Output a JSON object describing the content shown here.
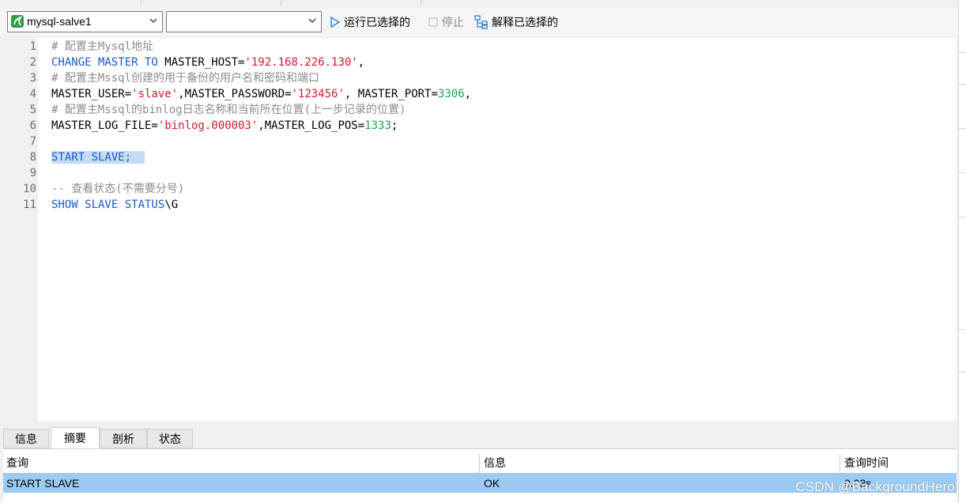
{
  "toolbar": {
    "connection": "mysql-salve1",
    "database": "",
    "run_selected": "运行已选择的",
    "stop": "停止",
    "explain_selected": "解释已选择的"
  },
  "editor": {
    "line_numbers": [
      "1",
      "2",
      "3",
      "4",
      "5",
      "6",
      "7",
      "8",
      "9",
      "10",
      "11"
    ],
    "lines": [
      [
        {
          "t": "# 配置主Mysql地址",
          "c": "cmt"
        }
      ],
      [
        {
          "t": "CHANGE MASTER TO",
          "c": "kw"
        },
        {
          "t": " MASTER_HOST=",
          "c": ""
        },
        {
          "t": "'192.168.226.130'",
          "c": "str"
        },
        {
          "t": ",",
          "c": ""
        }
      ],
      [
        {
          "t": "# 配置主Mssql创建的用于备份的用户名和密码和端口",
          "c": "cmt"
        }
      ],
      [
        {
          "t": "MASTER_USER=",
          "c": ""
        },
        {
          "t": "'slave'",
          "c": "str"
        },
        {
          "t": ",MASTER_PASSWORD=",
          "c": ""
        },
        {
          "t": "'123456'",
          "c": "str"
        },
        {
          "t": ", MASTER_PORT=",
          "c": ""
        },
        {
          "t": "3306",
          "c": "num"
        },
        {
          "t": ",",
          "c": ""
        }
      ],
      [
        {
          "t": "# 配置主Mssql的binlog日志名称和当前所在位置(上一步记录的位置)",
          "c": "cmt"
        }
      ],
      [
        {
          "t": "MASTER_LOG_FILE=",
          "c": ""
        },
        {
          "t": "'binlog.000003'",
          "c": "str"
        },
        {
          "t": ",MASTER_LOG_POS=",
          "c": ""
        },
        {
          "t": "1333",
          "c": "num"
        },
        {
          "t": ";",
          "c": ""
        }
      ],
      [],
      [
        {
          "t": "START SLAVE;",
          "c": "kw sel"
        },
        {
          "t": "  ",
          "c": "sel"
        }
      ],
      [],
      [
        {
          "t": "-- 查看状态(不需要分号)",
          "c": "cmt"
        }
      ],
      [
        {
          "t": "SHOW SLAVE STATUS",
          "c": "kw"
        },
        {
          "t": "\\G",
          "c": ""
        }
      ]
    ]
  },
  "tabs": [
    {
      "label": "信息",
      "active": false
    },
    {
      "label": "摘要",
      "active": true
    },
    {
      "label": "剖析",
      "active": false
    },
    {
      "label": "状态",
      "active": false
    }
  ],
  "result": {
    "headers": [
      "查询",
      "信息",
      "查询时间"
    ],
    "rows": [
      [
        "START SLAVE",
        "OK",
        "0.03s"
      ]
    ]
  },
  "watermark": "CSDN @BackgroundHero",
  "colors": {
    "keyword": "#1b5ac9",
    "string": "#d4192b",
    "number": "#12a84a",
    "comment": "#8c8c8c",
    "selection": "#c5dcf5",
    "selected_row": "#99cbf5"
  }
}
